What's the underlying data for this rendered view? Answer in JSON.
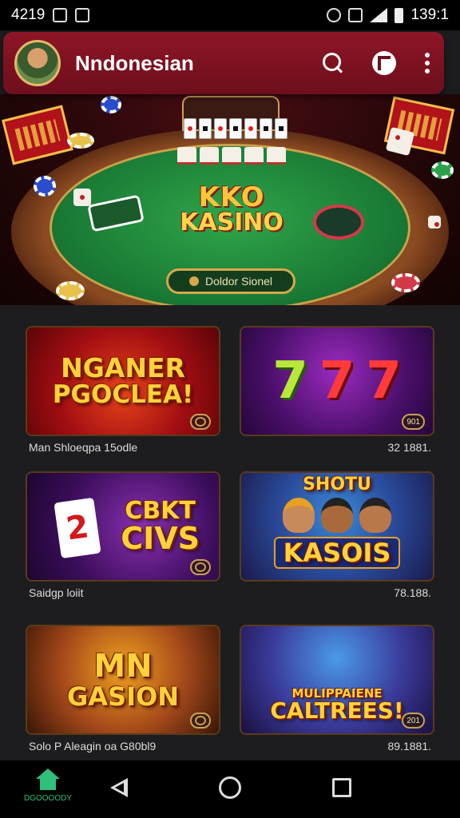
{
  "status": {
    "time": "4219",
    "clock": "139:1"
  },
  "header": {
    "title": "Nndonesian"
  },
  "hero": {
    "logo_line1": "KKO",
    "logo_line2": "KASINO",
    "button_label": "Doldor Sionel"
  },
  "games": [
    {
      "art_line1": "NGANER",
      "art_line2": "PGOCLEA!",
      "caption": "Man Shloeqpa 15odle",
      "value": "",
      "badge": ""
    },
    {
      "art_line1": "7",
      "art_line2": "",
      "caption": "",
      "value": "32 1881.",
      "badge": "901"
    },
    {
      "art_line1": "CBKT",
      "art_line2": "CIVS",
      "caption": "Saidgp loiit",
      "value": "",
      "badge": ""
    },
    {
      "art_line1": "SHOTU",
      "art_line2": "KASOIS",
      "caption": "",
      "value": "78.188.",
      "badge": ""
    },
    {
      "art_line1": "MN",
      "art_line2": "GASION",
      "caption": "Solo P Aleagin oa G80bl9",
      "value": "",
      "badge": ""
    },
    {
      "art_line1": "MULIPPAIENE",
      "art_line2": "CALTREES!",
      "caption": "",
      "value": "89.1881.",
      "badge": "201"
    }
  ],
  "nav": {
    "home_label": "DGOOOODY"
  },
  "colors": {
    "header_bg": "#8e1526",
    "accent_gold": "#d4a94a",
    "nav_active": "#2fc07a"
  }
}
